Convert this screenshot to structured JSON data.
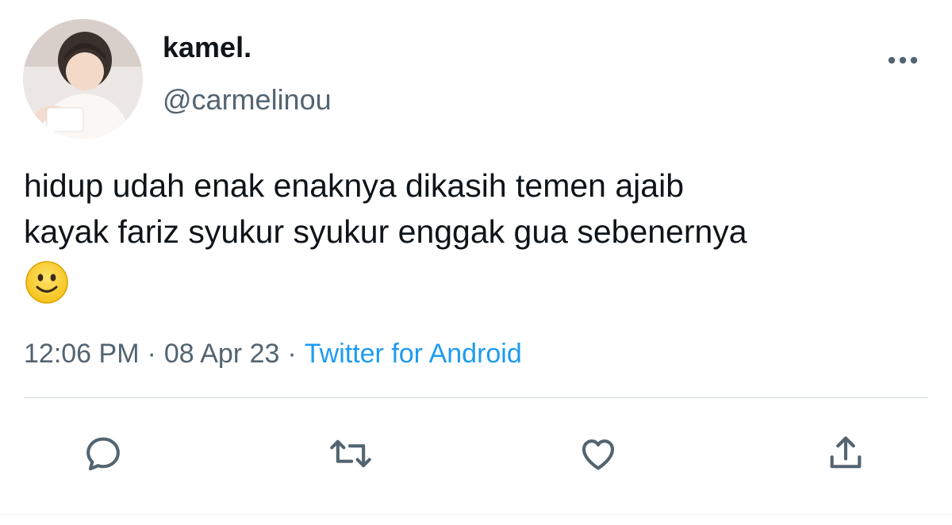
{
  "author": {
    "display_name": "kamel.",
    "handle": "@carmelinou"
  },
  "tweet": {
    "text": "hidup udah enak enaknya dikasih temen ajaib\nkayak fariz syukur syukur enggak gua sebenernya",
    "emoji": "slightly-smiling-face"
  },
  "meta": {
    "time": "12:06 PM",
    "date": "08 Apr 23",
    "separator": "·",
    "source": "Twitter for Android"
  },
  "icons": {
    "more": "more-horizontal-icon",
    "reply": "reply-icon",
    "retweet": "retweet-icon",
    "like": "heart-icon",
    "share": "share-icon"
  },
  "colors": {
    "text_primary": "#0f1419",
    "text_secondary": "#536471",
    "link": "#1d9bf0",
    "divider": "#cfd9de"
  }
}
